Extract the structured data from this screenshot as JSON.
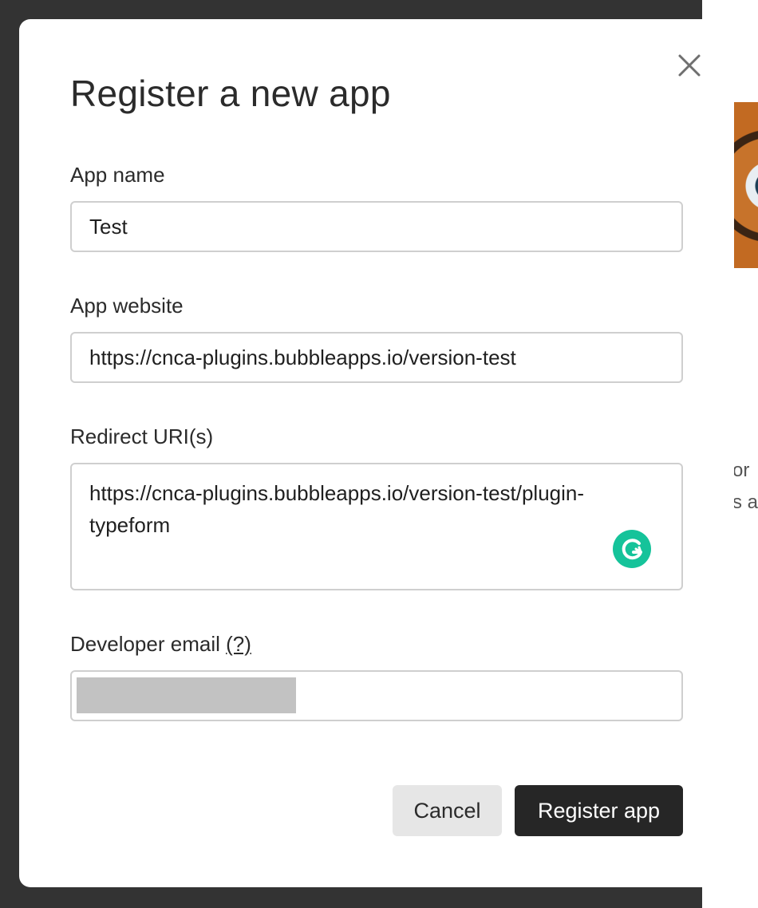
{
  "background": {
    "peek_text_1": "or",
    "peek_text_2": "s a"
  },
  "modal": {
    "title": "Register a new app",
    "close_icon": "close-icon",
    "fields": {
      "app_name": {
        "label": "App name",
        "value": "Test"
      },
      "app_website": {
        "label": "App website",
        "value": "https://cnca-plugins.bubbleapps.io/version-test"
      },
      "redirect_uris": {
        "label": "Redirect URI(s)",
        "value": "https://cnca-plugins.bubbleapps.io/version-test/plugin-typeform"
      },
      "developer_email": {
        "label": "Developer email",
        "help": "(?)",
        "value": ""
      }
    },
    "grammarly_icon": "grammarly-icon",
    "buttons": {
      "cancel": "Cancel",
      "register": "Register app"
    }
  },
  "colors": {
    "overlay": "#2f2f2f",
    "primary_button": "#262626",
    "secondary_button": "#e6e6e6",
    "grammarly": "#15c39a"
  }
}
